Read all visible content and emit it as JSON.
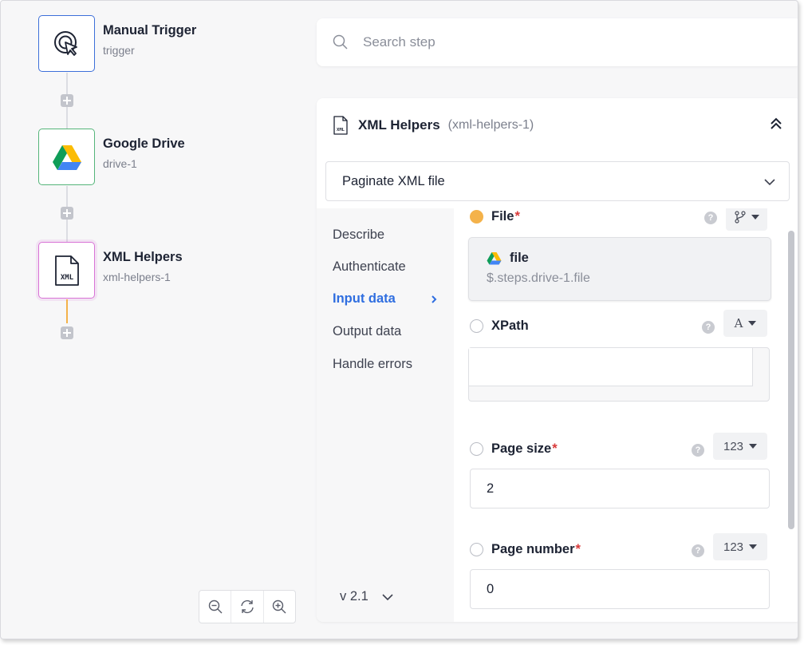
{
  "flow": {
    "nodes": [
      {
        "title": "Manual Trigger",
        "subtitle": "trigger",
        "icon": "cursor-click-icon",
        "border": "#3d6fd9"
      },
      {
        "title": "Google Drive",
        "subtitle": "drive-1",
        "icon": "google-drive-icon",
        "border": "#55b57a"
      },
      {
        "title": "XML Helpers",
        "subtitle": "xml-helpers-1",
        "icon": "xml-file-icon",
        "border": "#d873d6"
      }
    ],
    "active_connector_color": "#f4b24a"
  },
  "search": {
    "placeholder": "Search step"
  },
  "panel": {
    "icon_text": "XML",
    "title": "XML Helpers",
    "id_label": "(xml-helpers-1)",
    "action": "Paginate XML file",
    "menu": [
      "Describe",
      "Authenticate",
      "Input data",
      "Output data",
      "Handle errors"
    ],
    "active_menu": "Input data",
    "version": "v 2.1"
  },
  "fields": {
    "file": {
      "label": "File",
      "required_mark": "*",
      "card_name": "file",
      "card_path": "$.steps.drive-1.file"
    },
    "xpath": {
      "label": "XPath",
      "type_label": "A",
      "value": ""
    },
    "page_size": {
      "label": "Page size",
      "required_mark": "*",
      "type_label": "123",
      "value": "2"
    },
    "page_number": {
      "label": "Page number",
      "required_mark": "*",
      "type_label": "123",
      "value": "0"
    }
  },
  "colors": {
    "accent": "#2f6ee0",
    "required": "#d93a3a",
    "status_filled": "#f4b24a"
  }
}
